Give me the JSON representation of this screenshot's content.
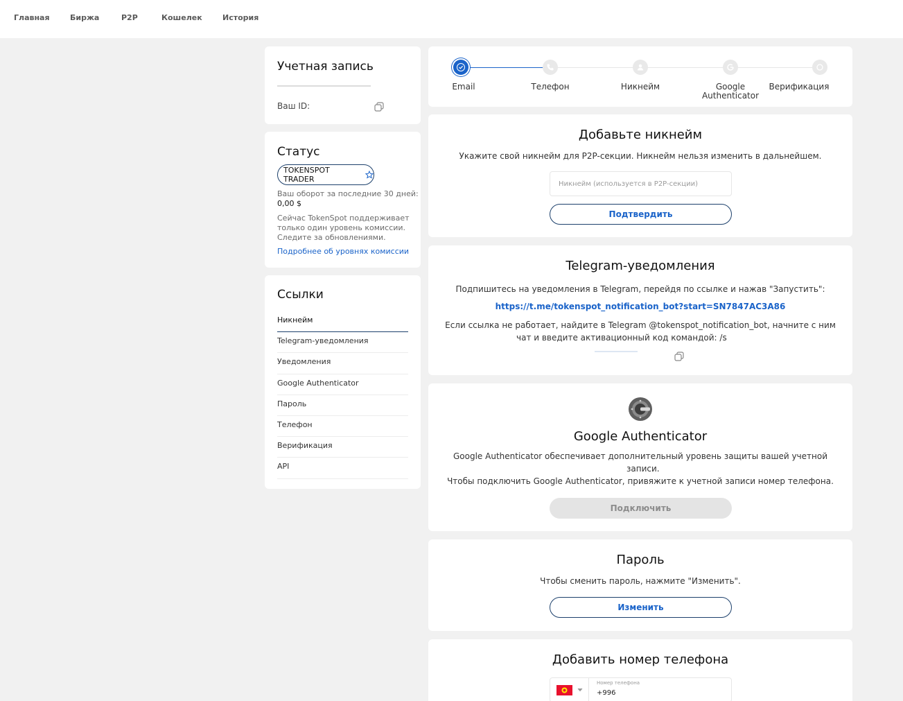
{
  "nav": {
    "items": [
      "Главная",
      "Биржа",
      "P2P",
      "Кошелек",
      "История"
    ]
  },
  "account": {
    "title": "Учетная запись",
    "id_label": "Ваш ID:"
  },
  "status": {
    "title": "Статус",
    "badge": "TOKENSPOT TRADER",
    "turnover_label": "Ваш оборот за последние 30 дней:",
    "turnover_value": "0,00 $",
    "note_lines": [
      "Сейчас TokenSpot поддерживает",
      "только один уровень комиссии.",
      "Следите за обновлениями."
    ],
    "link": "Подробнее об уровнях комиссии"
  },
  "links": {
    "title": "Ссылки",
    "items": [
      "Никнейм",
      "Telegram-уведомления",
      "Уведомления",
      "Google Authenticator",
      "Пароль",
      "Телефон",
      "Верификация",
      "API"
    ]
  },
  "steps": {
    "items": [
      {
        "label": "Email"
      },
      {
        "label": "Телефон"
      },
      {
        "label": "Никнейм"
      },
      {
        "label_lines": [
          "Google",
          "Authenticator"
        ]
      },
      {
        "label": "Верификация"
      }
    ]
  },
  "nickname": {
    "title": "Добавьте никнейм",
    "desc": "Укажите свой никнейм для P2P-секции. Никнейм нельзя изменить в дальнейшем.",
    "placeholder": "Никнейм (используется в P2P-секции)",
    "button": "Подтвердить"
  },
  "telegram": {
    "title": "Telegram-уведомления",
    "desc": "Подпишитесь на уведомления в Telegram, перейдя по ссылке и нажав \"Запустить\":",
    "link": "https://t.me/tokenspot_notification_bot?start=SN7847AC3A86",
    "fallback_line1": "Если ссылка не работает, найдите в Telegram @tokenspot_notification_bot, начните с ним",
    "fallback_line2": "чат и введите активационный код командой: /s"
  },
  "ga": {
    "title": "Google Authenticator",
    "desc_line1": "Google Authenticator обеспечивает дополнительный уровень защиты вашей учетной",
    "desc_line2": "записи.",
    "desc_line3": "Чтобы подключить Google Authenticator, привяжите к учетной записи номер телефона.",
    "button": "Подключить"
  },
  "password": {
    "title": "Пароль",
    "desc": "Чтобы сменить пароль, нажмите \"Изменить\".",
    "button": "Изменить"
  },
  "phone": {
    "title": "Добавить номер телефона",
    "field_label": "Номер телефона",
    "value": "+996"
  },
  "colors": {
    "accent": "#1a63c9",
    "dark_border": "#1b3f6b",
    "background": "#f1f1f1"
  }
}
